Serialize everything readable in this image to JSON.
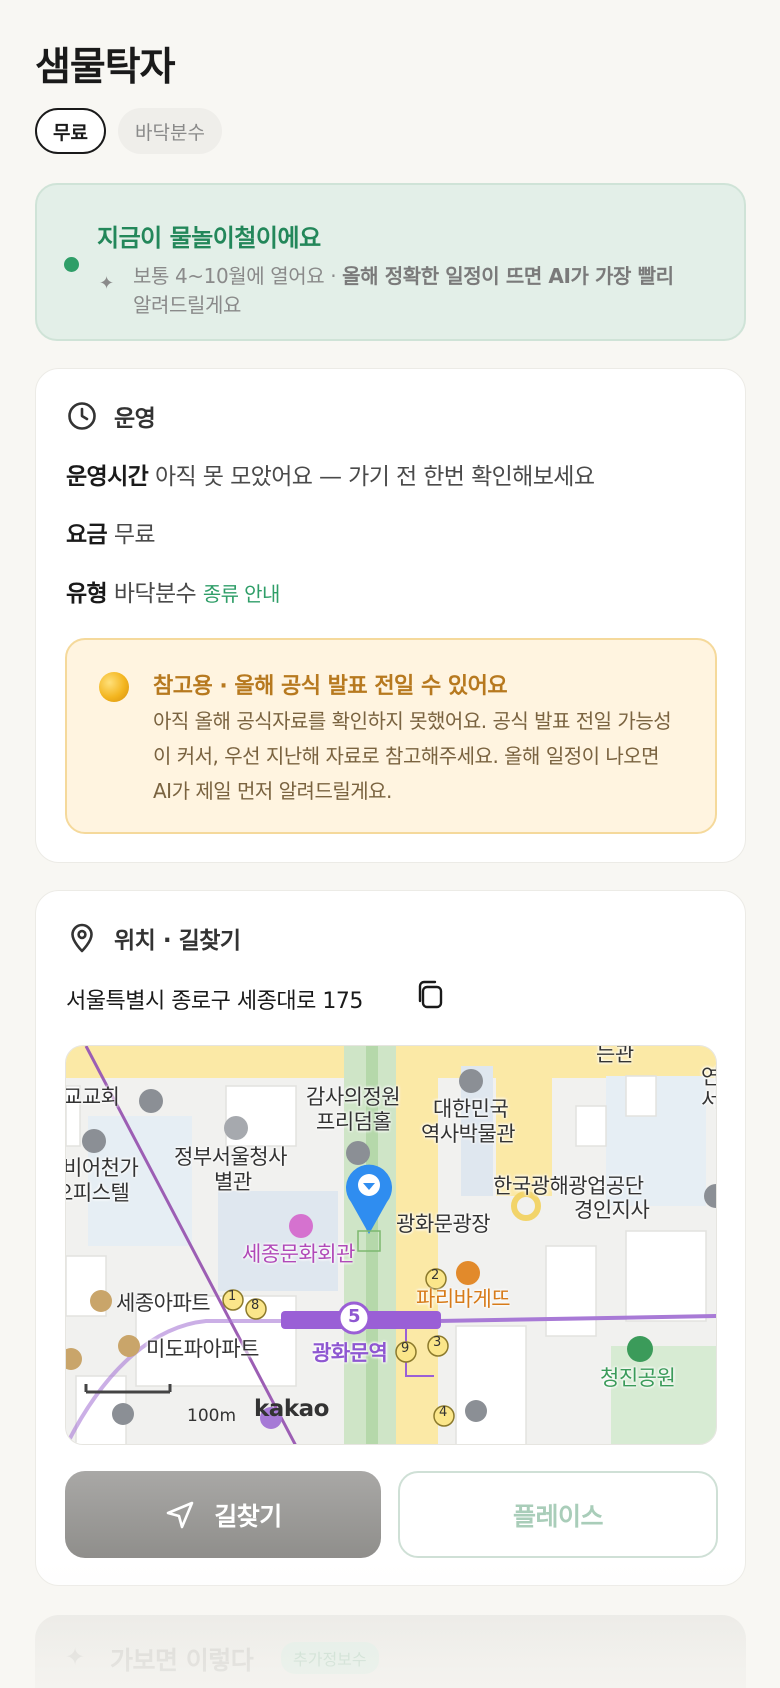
{
  "header": {
    "title": "샘물탁자"
  },
  "chips": [
    {
      "label": "무료",
      "selected": true
    },
    {
      "label": "바닥분수",
      "selected": false
    }
  ],
  "season": {
    "title": "지금이 물놀이철이에요",
    "desc_plain": "보통 4~10월에 열어요 · ",
    "desc_bold": "올해 정확한 일정이 뜨면 AI가 가장 빨리",
    "desc_tail": "알려드릴게요",
    "accent": "#2f9e68"
  },
  "operation": {
    "heading": "운영",
    "hours_key": "운영시간",
    "hours_value": "아직 못 모았어요 — 가기 전 한번 확인해보세요",
    "fee_key": "요금",
    "fee_value": "무료",
    "type_key": "유형",
    "type_value": "바닥분수",
    "type_link": "종류 안내",
    "notice": {
      "title": "참고용 · 올해 공식 발표 전일 수 있어요",
      "body": "아직 올해 공식자료를 확인하지 못했어요. 공식 발표 전일 가능성이 커서, 우선 지난해 자료로 참고해주세요. 올해 일정이 나오면 AI가 제일 먼저 알려드릴게요."
    }
  },
  "location": {
    "heading": "위치 · 길찾기",
    "address": "서울특별시 종로구 세종대로 175",
    "map": {
      "labels": {
        "church": "교교회",
        "audit": "감사의정원",
        "platform": "프리덤홀",
        "museum_1": "대한민국",
        "museum_2": "역사박물관",
        "gov_1": "정부서울청사",
        "gov_2": "별관",
        "beer_1": "비어천가",
        "beer_2": "오피스텔",
        "kosmo_1": "한국광해광업공단",
        "kosmo_2": "경인지사",
        "plaza": "광화문광장",
        "sejong_center": "세종문화회관",
        "paris": "파리바게뜨",
        "sejong_apt": "세종아파트",
        "mido_apt": "미도파아파트",
        "station": "광화문역",
        "cheongjin": "청진공원",
        "top_right": "는관",
        "edge_1": "연",
        "edge_2": "서",
        "line_number": "5",
        "exit_1": "1",
        "exit_8": "8",
        "exit_2": "2",
        "exit_9": "9",
        "exit_3": "3",
        "exit_4": "4"
      },
      "scale": "100m",
      "brand": "kakao"
    },
    "route_button": "길찾기",
    "place_button": "플레이스"
  },
  "next_section": {
    "title": "가보면 이렇다",
    "badge": "추가정보수"
  }
}
